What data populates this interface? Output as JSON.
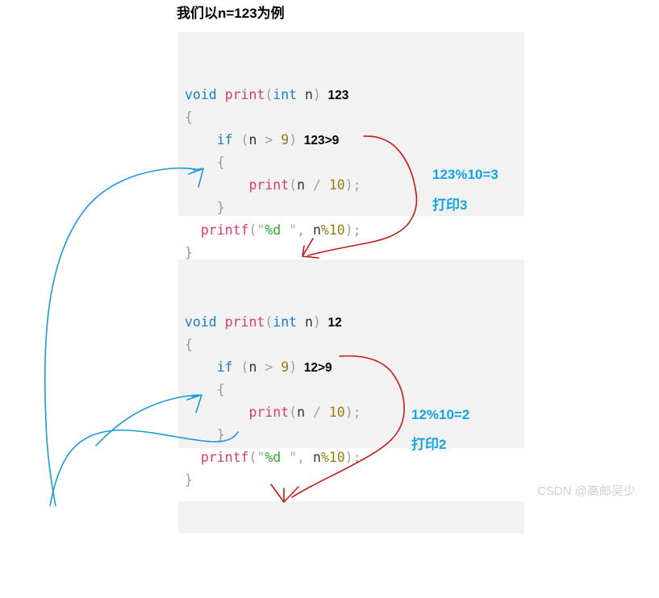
{
  "page": {
    "title": "我们以n=123为例",
    "watermark": "CSDN @高邮吴少",
    "background_color": "#ffffff"
  },
  "colors": {
    "code_background": "#f2f2f2",
    "keyword": "#1a7bc0",
    "function": "#d93c6b",
    "number": "#9a7d12",
    "punctuation": "#a0a0a0",
    "format_specifier": "#2fa82f",
    "annotation_blue": "#13a3e8",
    "annotation_black": "#000000",
    "arrow_red": "#c01a1a",
    "arrow_blue": "#1a9ad6",
    "watermark": "#cfcfcf"
  },
  "code_blocks": [
    {
      "id": "call-frame-1",
      "n_value": "123",
      "lines": [
        {
          "tokens": [
            {
              "t": "void",
              "c": "kw"
            },
            {
              "t": " ",
              "c": "pun"
            },
            {
              "t": "print",
              "c": "fn"
            },
            {
              "t": "(",
              "c": "pun"
            },
            {
              "t": "int",
              "c": "kw"
            },
            {
              "t": " ",
              "c": "pun"
            },
            {
              "t": "n",
              "c": "var"
            },
            {
              "t": ")",
              "c": "pun"
            }
          ],
          "annotation": "123"
        },
        {
          "tokens": [
            {
              "t": "{",
              "c": "brc"
            }
          ],
          "annotation": ""
        },
        {
          "tokens": [
            {
              "t": "    ",
              "c": "pun"
            },
            {
              "t": "if",
              "c": "kw"
            },
            {
              "t": " (",
              "c": "pun"
            },
            {
              "t": "n",
              "c": "var"
            },
            {
              "t": " > ",
              "c": "pun"
            },
            {
              "t": "9",
              "c": "num"
            },
            {
              "t": ")",
              "c": "pun"
            }
          ],
          "annotation": "123>9"
        },
        {
          "tokens": [
            {
              "t": "    ",
              "c": "pun"
            },
            {
              "t": "{",
              "c": "brc"
            }
          ],
          "annotation": ""
        },
        {
          "tokens": [
            {
              "t": "        ",
              "c": "pun"
            },
            {
              "t": "print",
              "c": "fn"
            },
            {
              "t": "(",
              "c": "pun"
            },
            {
              "t": "n",
              "c": "var"
            },
            {
              "t": " / ",
              "c": "pun"
            },
            {
              "t": "10",
              "c": "num"
            },
            {
              "t": ");",
              "c": "pun"
            }
          ],
          "annotation": ""
        },
        {
          "tokens": [
            {
              "t": "    ",
              "c": "pun"
            },
            {
              "t": "}",
              "c": "brc"
            }
          ],
          "annotation": ""
        },
        {
          "tokens": [
            {
              "t": "  ",
              "c": "pun"
            },
            {
              "t": "printf",
              "c": "fn"
            },
            {
              "t": "(",
              "c": "pun"
            },
            {
              "t": "\"",
              "c": "str"
            },
            {
              "t": "%d",
              "c": "fmt"
            },
            {
              "t": " \"",
              "c": "str"
            },
            {
              "t": ", ",
              "c": "pun"
            },
            {
              "t": "n",
              "c": "var"
            },
            {
              "t": "%",
              "c": "mod"
            },
            {
              "t": "10",
              "c": "num"
            },
            {
              "t": ");",
              "c": "pun"
            }
          ],
          "annotation": ""
        },
        {
          "tokens": [
            {
              "t": "}",
              "c": "brc"
            }
          ],
          "annotation": ""
        }
      ],
      "side_notes": [
        "123%10=3",
        "打印3"
      ]
    },
    {
      "id": "call-frame-2",
      "n_value": "12",
      "lines": [
        {
          "tokens": [
            {
              "t": "void",
              "c": "kw"
            },
            {
              "t": " ",
              "c": "pun"
            },
            {
              "t": "print",
              "c": "fn"
            },
            {
              "t": "(",
              "c": "pun"
            },
            {
              "t": "int",
              "c": "kw"
            },
            {
              "t": " ",
              "c": "pun"
            },
            {
              "t": "n",
              "c": "var"
            },
            {
              "t": ")",
              "c": "pun"
            }
          ],
          "annotation": "12"
        },
        {
          "tokens": [
            {
              "t": "{",
              "c": "brc"
            }
          ],
          "annotation": ""
        },
        {
          "tokens": [
            {
              "t": "    ",
              "c": "pun"
            },
            {
              "t": "if",
              "c": "kw"
            },
            {
              "t": " (",
              "c": "pun"
            },
            {
              "t": "n",
              "c": "var"
            },
            {
              "t": " > ",
              "c": "pun"
            },
            {
              "t": "9",
              "c": "num"
            },
            {
              "t": ")",
              "c": "pun"
            }
          ],
          "annotation": "12>9"
        },
        {
          "tokens": [
            {
              "t": "    ",
              "c": "pun"
            },
            {
              "t": "{",
              "c": "brc"
            }
          ],
          "annotation": ""
        },
        {
          "tokens": [
            {
              "t": "        ",
              "c": "pun"
            },
            {
              "t": "print",
              "c": "fn"
            },
            {
              "t": "(",
              "c": "pun"
            },
            {
              "t": "n",
              "c": "var"
            },
            {
              "t": " / ",
              "c": "pun"
            },
            {
              "t": "10",
              "c": "num"
            },
            {
              "t": ");",
              "c": "pun"
            }
          ],
          "annotation": ""
        },
        {
          "tokens": [
            {
              "t": "    ",
              "c": "pun"
            },
            {
              "t": "}",
              "c": "brc"
            }
          ],
          "annotation": ""
        },
        {
          "tokens": [
            {
              "t": "  ",
              "c": "pun"
            },
            {
              "t": "printf",
              "c": "fn"
            },
            {
              "t": "(",
              "c": "pun"
            },
            {
              "t": "\"",
              "c": "str"
            },
            {
              "t": "%d",
              "c": "fmt"
            },
            {
              "t": " \"",
              "c": "str"
            },
            {
              "t": ", ",
              "c": "pun"
            },
            {
              "t": "n",
              "c": "var"
            },
            {
              "t": "%",
              "c": "mod"
            },
            {
              "t": "10",
              "c": "num"
            },
            {
              "t": ");",
              "c": "pun"
            }
          ],
          "annotation": ""
        },
        {
          "tokens": [
            {
              "t": "}",
              "c": "brc"
            }
          ],
          "annotation": ""
        }
      ],
      "side_notes": [
        "12%10=2",
        "打印2"
      ]
    },
    {
      "id": "call-frame-3",
      "n_value": "",
      "lines": [],
      "side_notes": []
    }
  ],
  "annotations": {
    "blue_note_1": "123%10=3",
    "blue_note_2": "打印3",
    "blue_note_3": "12%10=2",
    "blue_note_4": "打印2",
    "black_note_1": "123",
    "black_note_2": "123>9",
    "black_note_3": "12",
    "black_note_4": "12>9"
  },
  "arrows": [
    {
      "name": "red-arrow-frame1-to-frame2",
      "color": "#c01a1a",
      "from": "print(n / 10); in frame 1",
      "to": "top of frame 2"
    },
    {
      "name": "red-arrow-frame2-to-frame3",
      "color": "#c01a1a",
      "from": "print(n / 10); in frame 2",
      "to": "top of frame 3"
    },
    {
      "name": "blue-arrow-frame2-return-to-frame1",
      "color": "#1a9ad6",
      "from": "below frame 2",
      "to": "printf line of frame 1"
    },
    {
      "name": "blue-arrow-frame3-return-to-frame2",
      "color": "#1a9ad6",
      "from": "bottom left",
      "to": "printf line of frame 2"
    }
  ]
}
